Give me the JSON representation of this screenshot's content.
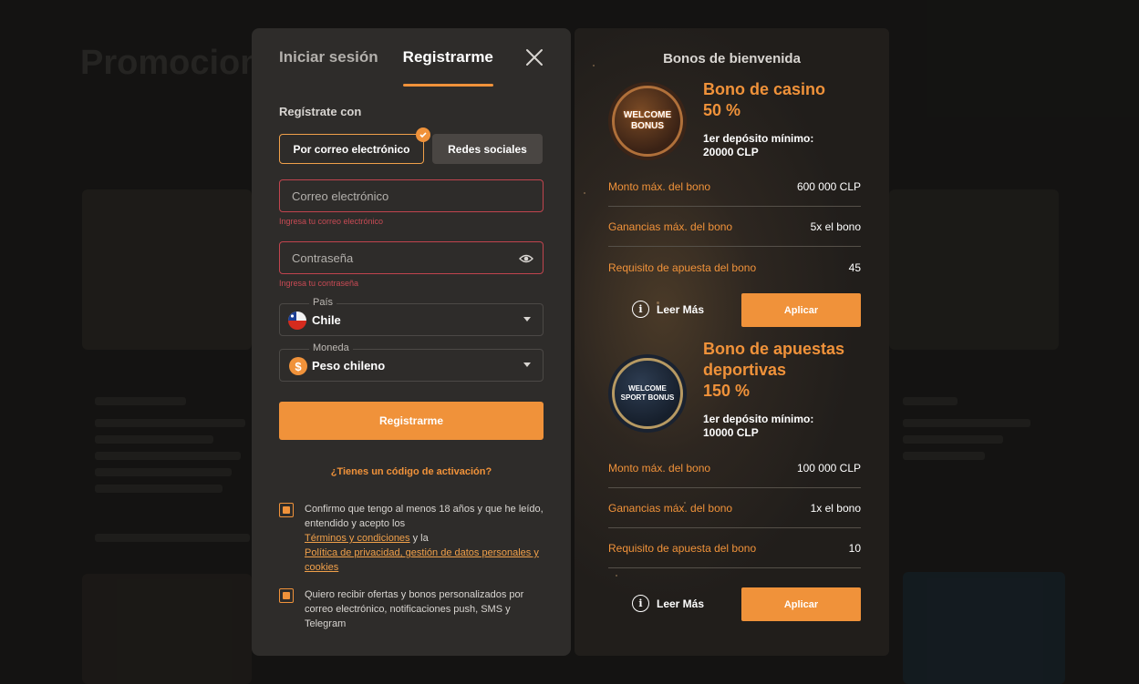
{
  "background": {
    "title": "Promociones"
  },
  "modal": {
    "tabs": [
      {
        "label": "Iniciar sesión"
      },
      {
        "label": "Registrarme"
      }
    ],
    "register_with_label": "Regístrate con",
    "methods": {
      "email": "Por correo electrónico",
      "social": "Redes sociales"
    },
    "email": {
      "placeholder": "Correo electrónico",
      "value": "",
      "error": "Ingresa tu correo electrónico"
    },
    "password": {
      "placeholder": "Contraseña",
      "value": "",
      "error": "Ingresa tu contraseña"
    },
    "country": {
      "legend": "País",
      "value": "Chile"
    },
    "currency": {
      "legend": "Moneda",
      "value": "Peso chileno",
      "symbol": "$"
    },
    "submit_label": "Registrarme",
    "activation_link": "¿Tienes un código de activación?",
    "consent1": {
      "text": "Confirmo que tengo al menos 18 años y que he leído, entendido y acepto los",
      "link1": "Términos y condiciones",
      "joiner": "y la",
      "link2": "Política de privacidad, gestión de datos personales y cookies",
      "checked": true
    },
    "consent2": {
      "text": "Quiero recibir ofertas y bonos personalizados por correo electrónico, notificaciones push, SMS y Telegram",
      "checked": true
    }
  },
  "bonus_panel": {
    "title": "Bonos de bienvenida",
    "bonuses": [
      {
        "name_line1": "Bono de casino",
        "name_line2": "50 %",
        "medal_line1": "WELCOME",
        "medal_line2": "BONUS",
        "min_deposit_label": "1er depósito mínimo:",
        "min_deposit_value": "20000 CLP",
        "rows": [
          {
            "key": "Monto máx. del bono",
            "value": "600 000 CLP"
          },
          {
            "key": "Ganancias máx. del bono",
            "value": "5x el bono"
          },
          {
            "key": "Requisito de apuesta del bono",
            "value": "45"
          }
        ],
        "read_more": "Leer Más",
        "apply": "Aplicar"
      },
      {
        "name_line1": "Bono de apuestas",
        "name_line2": "deportivas",
        "name_line3": "150 %",
        "medal_line1": "WELCOME",
        "medal_line2": "SPORT BONUS",
        "min_deposit_label": "1er depósito mínimo:",
        "min_deposit_value": "10000 CLP",
        "rows": [
          {
            "key": "Monto máx. del bono",
            "value": "100 000 CLP"
          },
          {
            "key": "Ganancias máx. del bono",
            "value": "1x el bono"
          },
          {
            "key": "Requisito de apuesta del bono",
            "value": "10"
          }
        ],
        "read_more": "Leer Más",
        "apply": "Aplicar"
      }
    ]
  },
  "colors": {
    "accent": "#f0923a",
    "modal_bg": "#2e2c2a",
    "error": "#c1444e"
  }
}
